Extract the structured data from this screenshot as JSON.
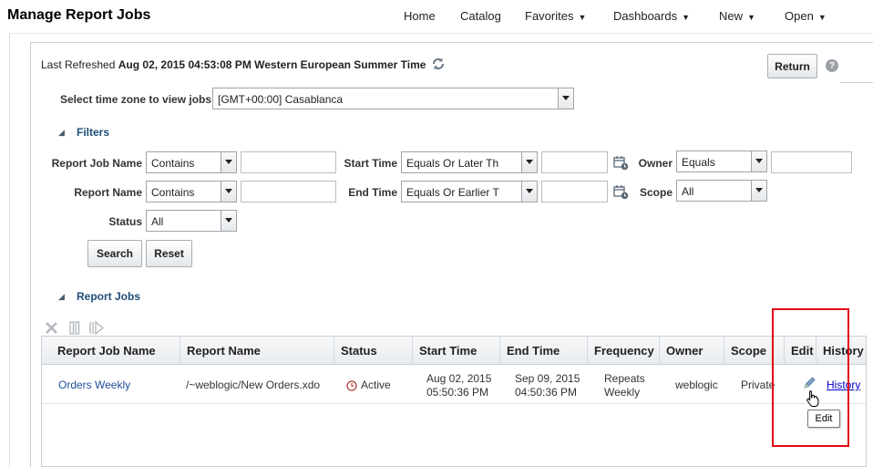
{
  "header": {
    "title": "Manage Report Jobs",
    "nav": {
      "home": "Home",
      "catalog": "Catalog",
      "favorites": "Favorites",
      "dashboards": "Dashboards",
      "new": "New",
      "open": "Open"
    }
  },
  "refresh": {
    "label": "Last Refreshed",
    "value": "Aug 02, 2015 04:53:08 PM Western European Summer Time"
  },
  "actions": {
    "return_label": "Return",
    "help_glyph": "?"
  },
  "timezone": {
    "label": "Select time zone to view jobs",
    "selected": "[GMT+00:00] Casablanca"
  },
  "filters": {
    "title": "Filters",
    "report_job_name": {
      "label": "Report Job Name",
      "operator": "Contains",
      "value": ""
    },
    "report_name": {
      "label": "Report Name",
      "operator": "Contains",
      "value": ""
    },
    "status": {
      "label": "Status",
      "selected": "All"
    },
    "start_time": {
      "label": "Start Time",
      "operator": "Equals Or Later Th",
      "value": ""
    },
    "end_time": {
      "label": "End Time",
      "operator": "Equals Or Earlier T",
      "value": ""
    },
    "owner": {
      "label": "Owner",
      "operator": "Equals",
      "value": ""
    },
    "scope": {
      "label": "Scope",
      "selected": "All"
    },
    "search_label": "Search",
    "reset_label": "Reset"
  },
  "report_jobs": {
    "title": "Report Jobs",
    "columns": [
      "Report Job Name",
      "Report Name",
      "Status",
      "Start Time",
      "End Time",
      "Frequency",
      "Owner",
      "Scope",
      "Edit",
      "History"
    ],
    "rows": [
      {
        "job_name": "Orders Weekly",
        "report_name": "/~weblogic/New Orders.xdo",
        "status": "Active",
        "start_date": "Aug 02, 2015",
        "start_clock": "05:50:36 PM",
        "end_date": "Sep 09, 2015",
        "end_clock": "04:50:36 PM",
        "frequency_line1": "Repeats",
        "frequency_line2": "Weekly",
        "owner": "weblogic",
        "scope": "Private",
        "history_link": "History"
      }
    ],
    "edit_tooltip": "Edit"
  },
  "icons": {
    "refresh": "refresh-icon",
    "calendar": "calendar-icon",
    "delete": "delete-icon",
    "pause": "pause-icon",
    "resume": "resume-icon",
    "status_clock": "clock-icon",
    "edit": "pencil-icon",
    "cursor": "hand-cursor-icon"
  },
  "colors": {
    "section_title": "#1f4e79",
    "link": "#1f4e99",
    "highlight": "#e30613"
  }
}
